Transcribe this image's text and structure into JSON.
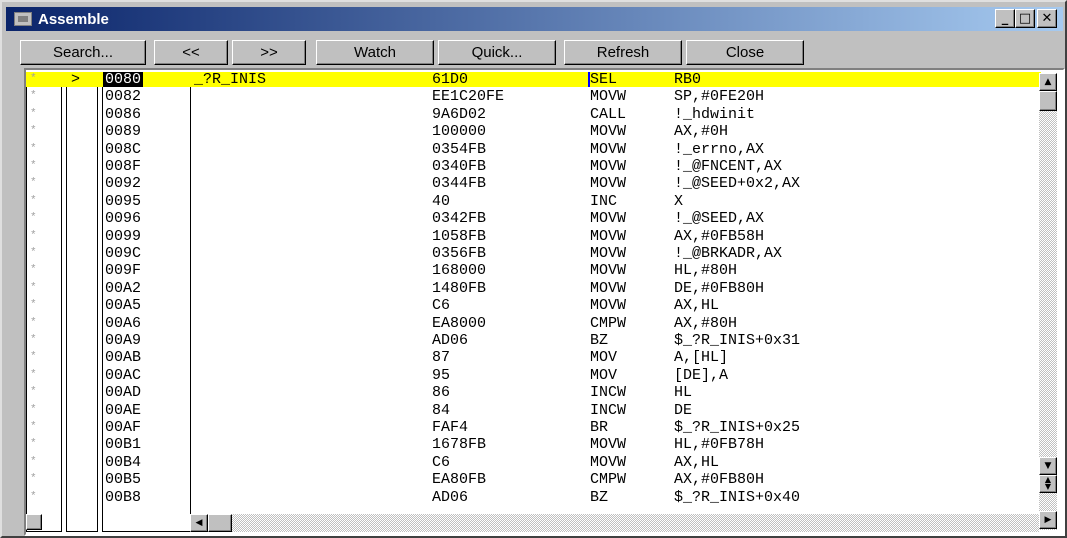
{
  "window": {
    "title": "Assemble",
    "controls": {
      "minimize": "_",
      "maximize": "□",
      "close": "✕"
    }
  },
  "toolbar": {
    "search": "Search...",
    "back": "<<",
    "forward": ">>",
    "watch": "Watch",
    "quick": "Quick...",
    "refresh": "Refresh",
    "close": "Close"
  },
  "colors": {
    "highlight": "#ffff00",
    "cursor": "#0000ff",
    "title_start": "#0a246a",
    "title_end": "#a6caf0"
  },
  "scroll_icons": {
    "up": "▲",
    "down": "▼",
    "left": "◀",
    "right": "▶",
    "page_up": "▲",
    "page_down": "▼"
  },
  "listing": [
    {
      "bp": "*",
      "marker": ">",
      "addr": "0080",
      "label": "_?R_INIS",
      "code": "61D0",
      "mnemonic": "SEL",
      "operand": "RB0"
    },
    {
      "bp": "*",
      "marker": "",
      "addr": "0082",
      "label": "",
      "code": "EE1C20FE",
      "mnemonic": "MOVW",
      "operand": "SP,#0FE20H"
    },
    {
      "bp": "*",
      "marker": "",
      "addr": "0086",
      "label": "",
      "code": "9A6D02",
      "mnemonic": "CALL",
      "operand": "!_hdwinit"
    },
    {
      "bp": "*",
      "marker": "",
      "addr": "0089",
      "label": "",
      "code": "100000",
      "mnemonic": "MOVW",
      "operand": "AX,#0H"
    },
    {
      "bp": "*",
      "marker": "",
      "addr": "008C",
      "label": "",
      "code": "0354FB",
      "mnemonic": "MOVW",
      "operand": "!_errno,AX"
    },
    {
      "bp": "*",
      "marker": "",
      "addr": "008F",
      "label": "",
      "code": "0340FB",
      "mnemonic": "MOVW",
      "operand": "!_@FNCENT,AX"
    },
    {
      "bp": "*",
      "marker": "",
      "addr": "0092",
      "label": "",
      "code": "0344FB",
      "mnemonic": "MOVW",
      "operand": "!_@SEED+0x2,AX"
    },
    {
      "bp": "*",
      "marker": "",
      "addr": "0095",
      "label": "",
      "code": "40",
      "mnemonic": "INC",
      "operand": "X"
    },
    {
      "bp": "*",
      "marker": "",
      "addr": "0096",
      "label": "",
      "code": "0342FB",
      "mnemonic": "MOVW",
      "operand": "!_@SEED,AX"
    },
    {
      "bp": "*",
      "marker": "",
      "addr": "0099",
      "label": "",
      "code": "1058FB",
      "mnemonic": "MOVW",
      "operand": "AX,#0FB58H"
    },
    {
      "bp": "*",
      "marker": "",
      "addr": "009C",
      "label": "",
      "code": "0356FB",
      "mnemonic": "MOVW",
      "operand": "!_@BRKADR,AX"
    },
    {
      "bp": "*",
      "marker": "",
      "addr": "009F",
      "label": "",
      "code": "168000",
      "mnemonic": "MOVW",
      "operand": "HL,#80H"
    },
    {
      "bp": "*",
      "marker": "",
      "addr": "00A2",
      "label": "",
      "code": "1480FB",
      "mnemonic": "MOVW",
      "operand": "DE,#0FB80H"
    },
    {
      "bp": "*",
      "marker": "",
      "addr": "00A5",
      "label": "",
      "code": "C6",
      "mnemonic": "MOVW",
      "operand": "AX,HL"
    },
    {
      "bp": "*",
      "marker": "",
      "addr": "00A6",
      "label": "",
      "code": "EA8000",
      "mnemonic": "CMPW",
      "operand": "AX,#80H"
    },
    {
      "bp": "*",
      "marker": "",
      "addr": "00A9",
      "label": "",
      "code": "AD06",
      "mnemonic": "BZ",
      "operand": "$_?R_INIS+0x31"
    },
    {
      "bp": "*",
      "marker": "",
      "addr": "00AB",
      "label": "",
      "code": "87",
      "mnemonic": "MOV",
      "operand": "A,[HL]"
    },
    {
      "bp": "*",
      "marker": "",
      "addr": "00AC",
      "label": "",
      "code": "95",
      "mnemonic": "MOV",
      "operand": "[DE],A"
    },
    {
      "bp": "*",
      "marker": "",
      "addr": "00AD",
      "label": "",
      "code": "86",
      "mnemonic": "INCW",
      "operand": "HL"
    },
    {
      "bp": "*",
      "marker": "",
      "addr": "00AE",
      "label": "",
      "code": "84",
      "mnemonic": "INCW",
      "operand": "DE"
    },
    {
      "bp": "*",
      "marker": "",
      "addr": "00AF",
      "label": "",
      "code": "FAF4",
      "mnemonic": "BR",
      "operand": "$_?R_INIS+0x25"
    },
    {
      "bp": "*",
      "marker": "",
      "addr": "00B1",
      "label": "",
      "code": "1678FB",
      "mnemonic": "MOVW",
      "operand": "HL,#0FB78H"
    },
    {
      "bp": "*",
      "marker": "",
      "addr": "00B4",
      "label": "",
      "code": "C6",
      "mnemonic": "MOVW",
      "operand": "AX,HL"
    },
    {
      "bp": "*",
      "marker": "",
      "addr": "00B5",
      "label": "",
      "code": "EA80FB",
      "mnemonic": "CMPW",
      "operand": "AX,#0FB80H"
    },
    {
      "bp": "*",
      "marker": "",
      "addr": "00B8",
      "label": "",
      "code": "AD06",
      "mnemonic": "BZ",
      "operand": "$_?R_INIS+0x40"
    }
  ]
}
